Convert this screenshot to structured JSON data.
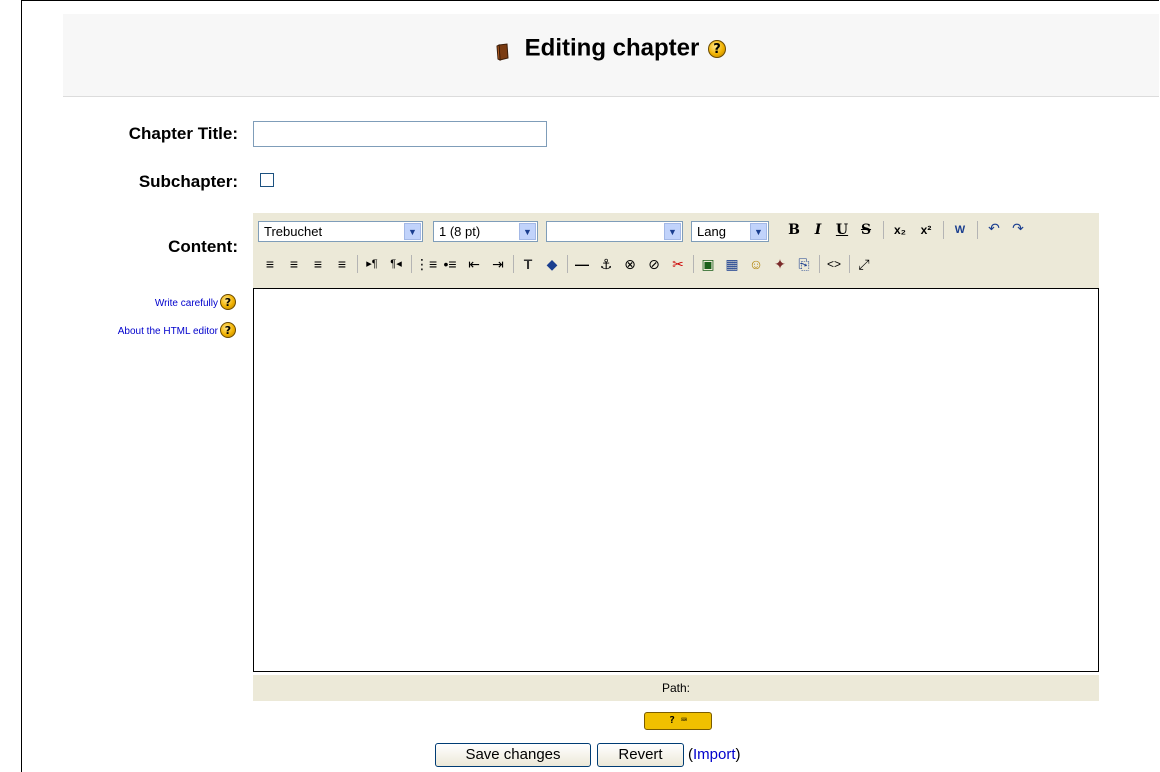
{
  "header": {
    "title": "Editing chapter",
    "title_help": "?"
  },
  "form": {
    "chapter_title_label": "Chapter Title:",
    "chapter_title_value": "",
    "subchapter_label": "Subchapter:",
    "content_label": "Content:",
    "help_links": [
      "Write carefully",
      "About the HTML editor"
    ]
  },
  "editor": {
    "font_select": "Trebuchet",
    "size_select": "1 (8 pt)",
    "style_select": "",
    "lang_select": "Lang",
    "path_label": "Path:",
    "kb_help": "? ⌨",
    "toolbar_glyphs": {
      "bold": "B",
      "italic": "I",
      "underline": "U",
      "strike": "S",
      "subscript": "x₂",
      "superscript": "x²",
      "undo": "↶",
      "redo": "↷",
      "align_left": "≡",
      "align_center": "≡",
      "align_right": "≡",
      "justify": "≡",
      "ltr": "▸¶",
      "rtl": "¶◂",
      "ordered_list": "⋮≡",
      "unordered_list": "•≡",
      "outdent": "⇤",
      "indent": "⇥",
      "text_color": "T",
      "bg_color": "◆",
      "hr": "—",
      "anchor": "⚓",
      "link": "⊗",
      "unlink": "⊘",
      "nolink": "✂",
      "image": "▣",
      "table": "▦",
      "smiley": "☺",
      "special_char": "✦",
      "search_replace": "⎘",
      "html_mode": "<>",
      "fullscreen": "⤢",
      "clean_word": "W",
      "help": "?"
    }
  },
  "actions": {
    "save": "Save changes",
    "revert": "Revert",
    "import_link": "Import",
    "import_open": "(",
    "import_close": ")"
  },
  "colors": {
    "link": "#0000cc",
    "toolbar_bg": "#ece9d8",
    "header_bg": "#f7f7f7",
    "help_icon": "#f1b200"
  }
}
